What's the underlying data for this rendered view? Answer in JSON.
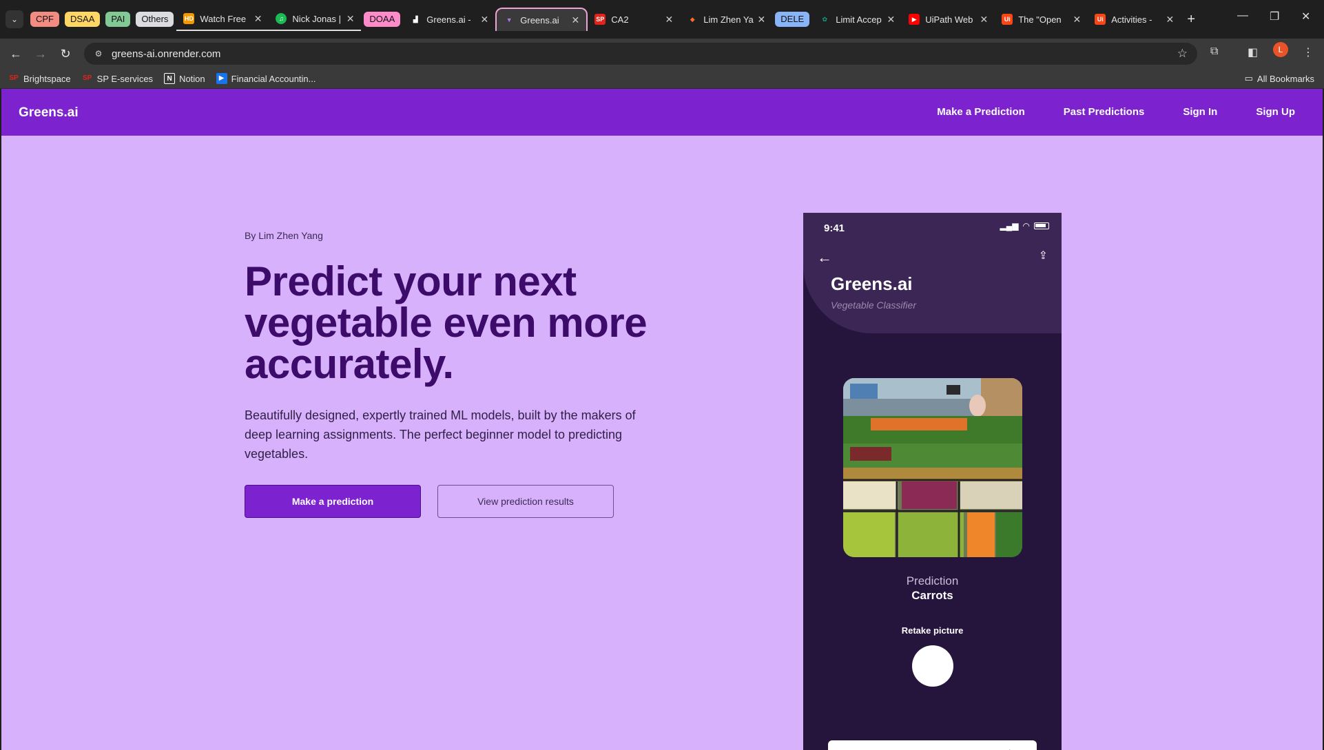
{
  "browser": {
    "tab_groups": [
      {
        "label": "CPF",
        "color": "#f28b82"
      },
      {
        "label": "DSAA",
        "color": "#fdd663"
      },
      {
        "label": "PAI",
        "color": "#81c995"
      },
      {
        "label": "Others",
        "color": "#dadce0"
      }
    ],
    "tabs": [
      {
        "title": "Watch Free",
        "icon_color": "#f29900",
        "icon_text": "HD"
      },
      {
        "title": "Nick Jonas |",
        "icon_color": "#1db954",
        "icon_text": "♫"
      },
      {
        "group": "DOAA",
        "group_color": "#ff8bcb"
      },
      {
        "title": "Greens.ai - ",
        "icon_color": "#ffffff",
        "icon_text": "▟"
      },
      {
        "title": "Greens.ai",
        "icon_color": "#a77ef5",
        "icon_text": "▼",
        "active": true
      },
      {
        "title": "CA2",
        "icon_color": "#e2231a",
        "icon_text": "SP"
      },
      {
        "title": "Lim Zhen Ya",
        "icon_color": "#fc6d26",
        "icon_text": "◆"
      },
      {
        "group": "DELE",
        "group_color": "#8ab4f8"
      },
      {
        "title": "Limit Accep",
        "icon_color": "#10a37f",
        "icon_text": "✿"
      },
      {
        "title": "UiPath Web",
        "icon_color": "#ff0000",
        "icon_text": "▶"
      },
      {
        "title": "The \"Open",
        "icon_color": "#fa4616",
        "icon_text": "Ui"
      },
      {
        "title": "Activities - ",
        "icon_color": "#fa4616",
        "icon_text": "Ui"
      }
    ],
    "url": "greens-ai.onrender.com",
    "profile_initial": "L",
    "bookmarks": [
      {
        "label": "Brightspace",
        "icon_text": "SP",
        "icon_color": "#e2231a"
      },
      {
        "label": "SP E-services",
        "icon_text": "SP",
        "icon_color": "#e2231a"
      },
      {
        "label": "Notion",
        "icon_text": "N",
        "icon_color": "#ffffff"
      },
      {
        "label": "Financial Accountin...",
        "icon_text": "▶",
        "icon_color": "#1a73e8"
      }
    ],
    "all_bookmarks_label": "All Bookmarks"
  },
  "site": {
    "brand": "Greens.ai",
    "nav": [
      "Make a Prediction",
      "Past Predictions",
      "Sign In",
      "Sign Up"
    ],
    "byline": "By Lim Zhen Yang",
    "title": "Predict your next vegetable even more accurately.",
    "subtitle": "Beautifully designed, expertly trained ML models, built by the makers of deep learning assignments. The perfect beginner model to predicting vegetables.",
    "primary_button": "Make a prediction",
    "secondary_button": "View prediction results",
    "accent": "#7c22cf",
    "background": "#d7b1fb"
  },
  "phone": {
    "time": "9:41",
    "app_title": "Greens.ai",
    "app_subtitle": "Vegetable Classifier",
    "prediction_label": "Prediction",
    "prediction_value": "Carrots",
    "retake_label": "Retake picture",
    "tabbar_icons": [
      "home-icon",
      "search-icon",
      "bookmark-icon",
      "settings-icon"
    ]
  }
}
